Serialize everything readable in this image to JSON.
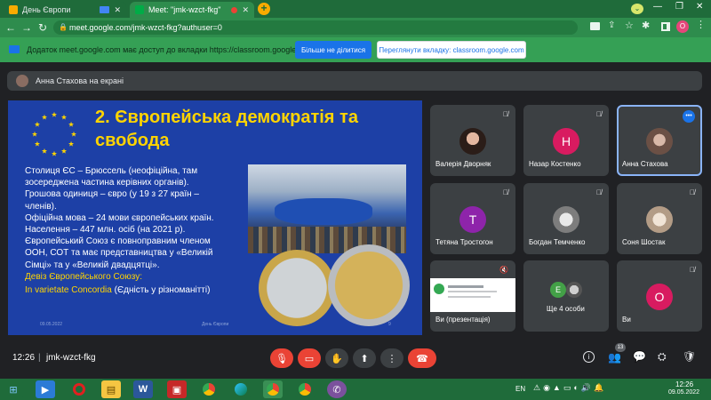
{
  "browser": {
    "tabs": [
      {
        "label": "День Європи",
        "active": false
      },
      {
        "label": "Meet: \"jmk-wzct-fkg\"",
        "active": true
      }
    ],
    "new_tab": "+",
    "url": "meet.google.com/jmk-wzct-fkg?authuser=0",
    "infobar_text": "Додаток meet.google.com має доступ до вкладки https://classroom.google.com",
    "infobar_button1": "Більше не ділитися",
    "infobar_button2": "Переглянути вкладку: classroom.google.com"
  },
  "meet": {
    "presenter_banner": "Анна Стахова на екрані",
    "slide": {
      "title_line1": "2. Європейська демократія та",
      "title_line2": "свобода",
      "lines": [
        "Столиця ЄС – Брюссель (неофіційна, там",
        "зосереджена частина керівних органів).",
        "Грошова одиниця – євро (у 19 з 27 країн –",
        "членів).",
        "Офіційна мова – 24 мови європейських країн.",
        "Населення – 447 млн. осіб (на 2021 р).",
        "Європейський Союз є повноправним членом",
        "ООН, СОТ  та має представництва у «Великій",
        "Сімці» та у «Великій двадцятці».",
        "Девіз Європейського Союзу:"
      ],
      "motto_latin": "In varietate Concordia",
      "motto_translation": " (Єдність у різноманітті)",
      "footer_date": "09.05.2022",
      "footer_center": "День Європи",
      "footer_page": "9"
    },
    "participants": [
      {
        "name": "Валерія Дворняк",
        "type": "photo"
      },
      {
        "name": "Назар Костенко",
        "type": "letter",
        "letter": "Н",
        "color": "#d81b60"
      },
      {
        "name": "Анна Стахова",
        "type": "photo",
        "speaking": true
      },
      {
        "name": "Тетяна Тростогон",
        "type": "letter",
        "letter": "Т",
        "color": "#8e24aa"
      },
      {
        "name": "Богдан Темченко",
        "type": "photo"
      },
      {
        "name": "Соня Шостак",
        "type": "photo"
      },
      {
        "name": "Ви (презентація)",
        "type": "presentation"
      },
      {
        "name": "Ще 4 особи",
        "type": "group",
        "letter": "Е"
      },
      {
        "name": "Ви",
        "type": "letter",
        "letter": "О",
        "color": "#d81b60"
      }
    ],
    "bottom": {
      "time": "12:26",
      "separator": "|",
      "meeting_code": "jmk-wzct-fkg",
      "participants_count": "13"
    }
  },
  "taskbar": {
    "lang": "EN",
    "time": "12:26",
    "date": "09.05.2022"
  },
  "colors": {
    "accent": "#1a73e8",
    "end_call": "#ea4335",
    "browser_green": "#2e8c4d"
  }
}
